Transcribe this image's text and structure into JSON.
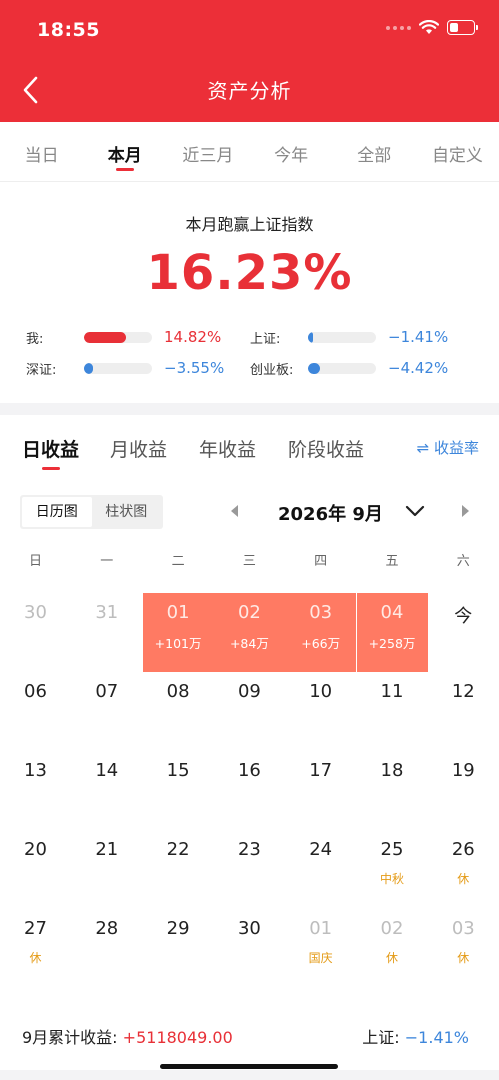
{
  "status": {
    "time": "18:55",
    "battery_level": 0.35
  },
  "header": {
    "title": "资产分析"
  },
  "period_tabs": [
    {
      "label": "当日"
    },
    {
      "label": "本月",
      "active": true
    },
    {
      "label": "近三月"
    },
    {
      "label": "今年"
    },
    {
      "label": "全部"
    },
    {
      "label": "自定义"
    }
  ],
  "summary": {
    "title": "本月跑赢上证指数",
    "percent": "16.23%",
    "comparisons": [
      {
        "label": "我:",
        "value": "14.82%",
        "fill": 0.62,
        "color": "#e83037",
        "tone": "red"
      },
      {
        "label": "上证:",
        "value": "−1.41%",
        "fill": 0.05,
        "color": "#3d86db",
        "tone": "blue"
      },
      {
        "label": "深证:",
        "value": "−3.55%",
        "fill": 0.13,
        "color": "#3d86db",
        "tone": "blue"
      },
      {
        "label": "创业板:",
        "value": "−4.42%",
        "fill": 0.18,
        "color": "#3d86db",
        "tone": "blue"
      }
    ]
  },
  "income_tabs": [
    {
      "label": "日收益",
      "active": true
    },
    {
      "label": "月收益"
    },
    {
      "label": "年收益"
    },
    {
      "label": "阶段收益"
    }
  ],
  "rate_toggle": {
    "icon": "swap-icon",
    "label": "⇌ 收益率"
  },
  "view_toggle": [
    {
      "label": "日历图",
      "active": true
    },
    {
      "label": "柱状图"
    }
  ],
  "month": {
    "label": "2026年 9月"
  },
  "weekdays": [
    "日",
    "一",
    "二",
    "三",
    "四",
    "五",
    "六"
  ],
  "calendar": [
    [
      {
        "day": "30",
        "muted": true
      },
      {
        "day": "31",
        "muted": true
      },
      {
        "day": "01",
        "profit": "+101万"
      },
      {
        "day": "02",
        "profit": "+84万"
      },
      {
        "day": "03",
        "profit": "+66万"
      },
      {
        "day": "04",
        "profit": "+258万"
      },
      {
        "day": "今"
      }
    ],
    [
      {
        "day": "06"
      },
      {
        "day": "07"
      },
      {
        "day": "08"
      },
      {
        "day": "09"
      },
      {
        "day": "10"
      },
      {
        "day": "11"
      },
      {
        "day": "12"
      }
    ],
    [
      {
        "day": "13"
      },
      {
        "day": "14"
      },
      {
        "day": "15"
      },
      {
        "day": "16"
      },
      {
        "day": "17"
      },
      {
        "day": "18"
      },
      {
        "day": "19"
      }
    ],
    [
      {
        "day": "20"
      },
      {
        "day": "21"
      },
      {
        "day": "22"
      },
      {
        "day": "23"
      },
      {
        "day": "24"
      },
      {
        "day": "25",
        "note": "中秋"
      },
      {
        "day": "26",
        "note": "休"
      }
    ],
    [
      {
        "day": "27",
        "note": "休"
      },
      {
        "day": "28"
      },
      {
        "day": "29"
      },
      {
        "day": "30"
      },
      {
        "day": "01",
        "muted": true,
        "note": "国庆"
      },
      {
        "day": "02",
        "muted": true,
        "note": "休"
      },
      {
        "day": "03",
        "muted": true,
        "note": "休"
      }
    ]
  ],
  "footer": {
    "cum_label": "9月累计收益:",
    "cum_value": "+5118049.00",
    "idx_label": "上证:",
    "idx_value": "−1.41%"
  },
  "colors": {
    "brand": "#ec2f38",
    "profit_cell": "#ff7a63",
    "holiday": "#e49b17",
    "loss_blue": "#3d86db"
  }
}
